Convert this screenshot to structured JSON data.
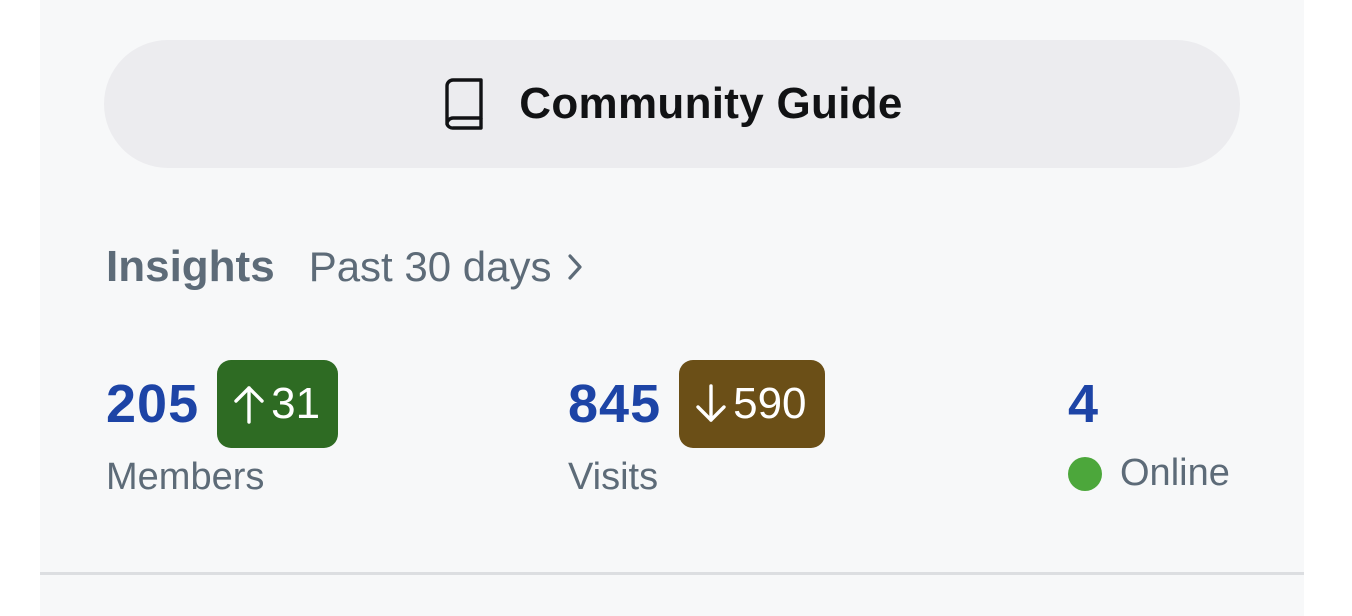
{
  "guide_button": {
    "label": "Community Guide",
    "icon": "book-icon"
  },
  "insights": {
    "title": "Insights",
    "period": "Past 30 days",
    "period_icon": "chevron-right-icon"
  },
  "stats": {
    "members": {
      "value": "205",
      "label": "Members",
      "change": "31",
      "direction": "up",
      "badge_color": "#2e6b23"
    },
    "visits": {
      "value": "845",
      "label": "Visits",
      "change": "590",
      "direction": "down",
      "badge_color": "#6b4f17"
    },
    "online": {
      "value": "4",
      "label": "Online",
      "status_color": "#4ca73b"
    }
  },
  "colors": {
    "accent_number": "#1d44a6",
    "muted_text": "#5d6b78",
    "button_bg": "#ececef"
  }
}
